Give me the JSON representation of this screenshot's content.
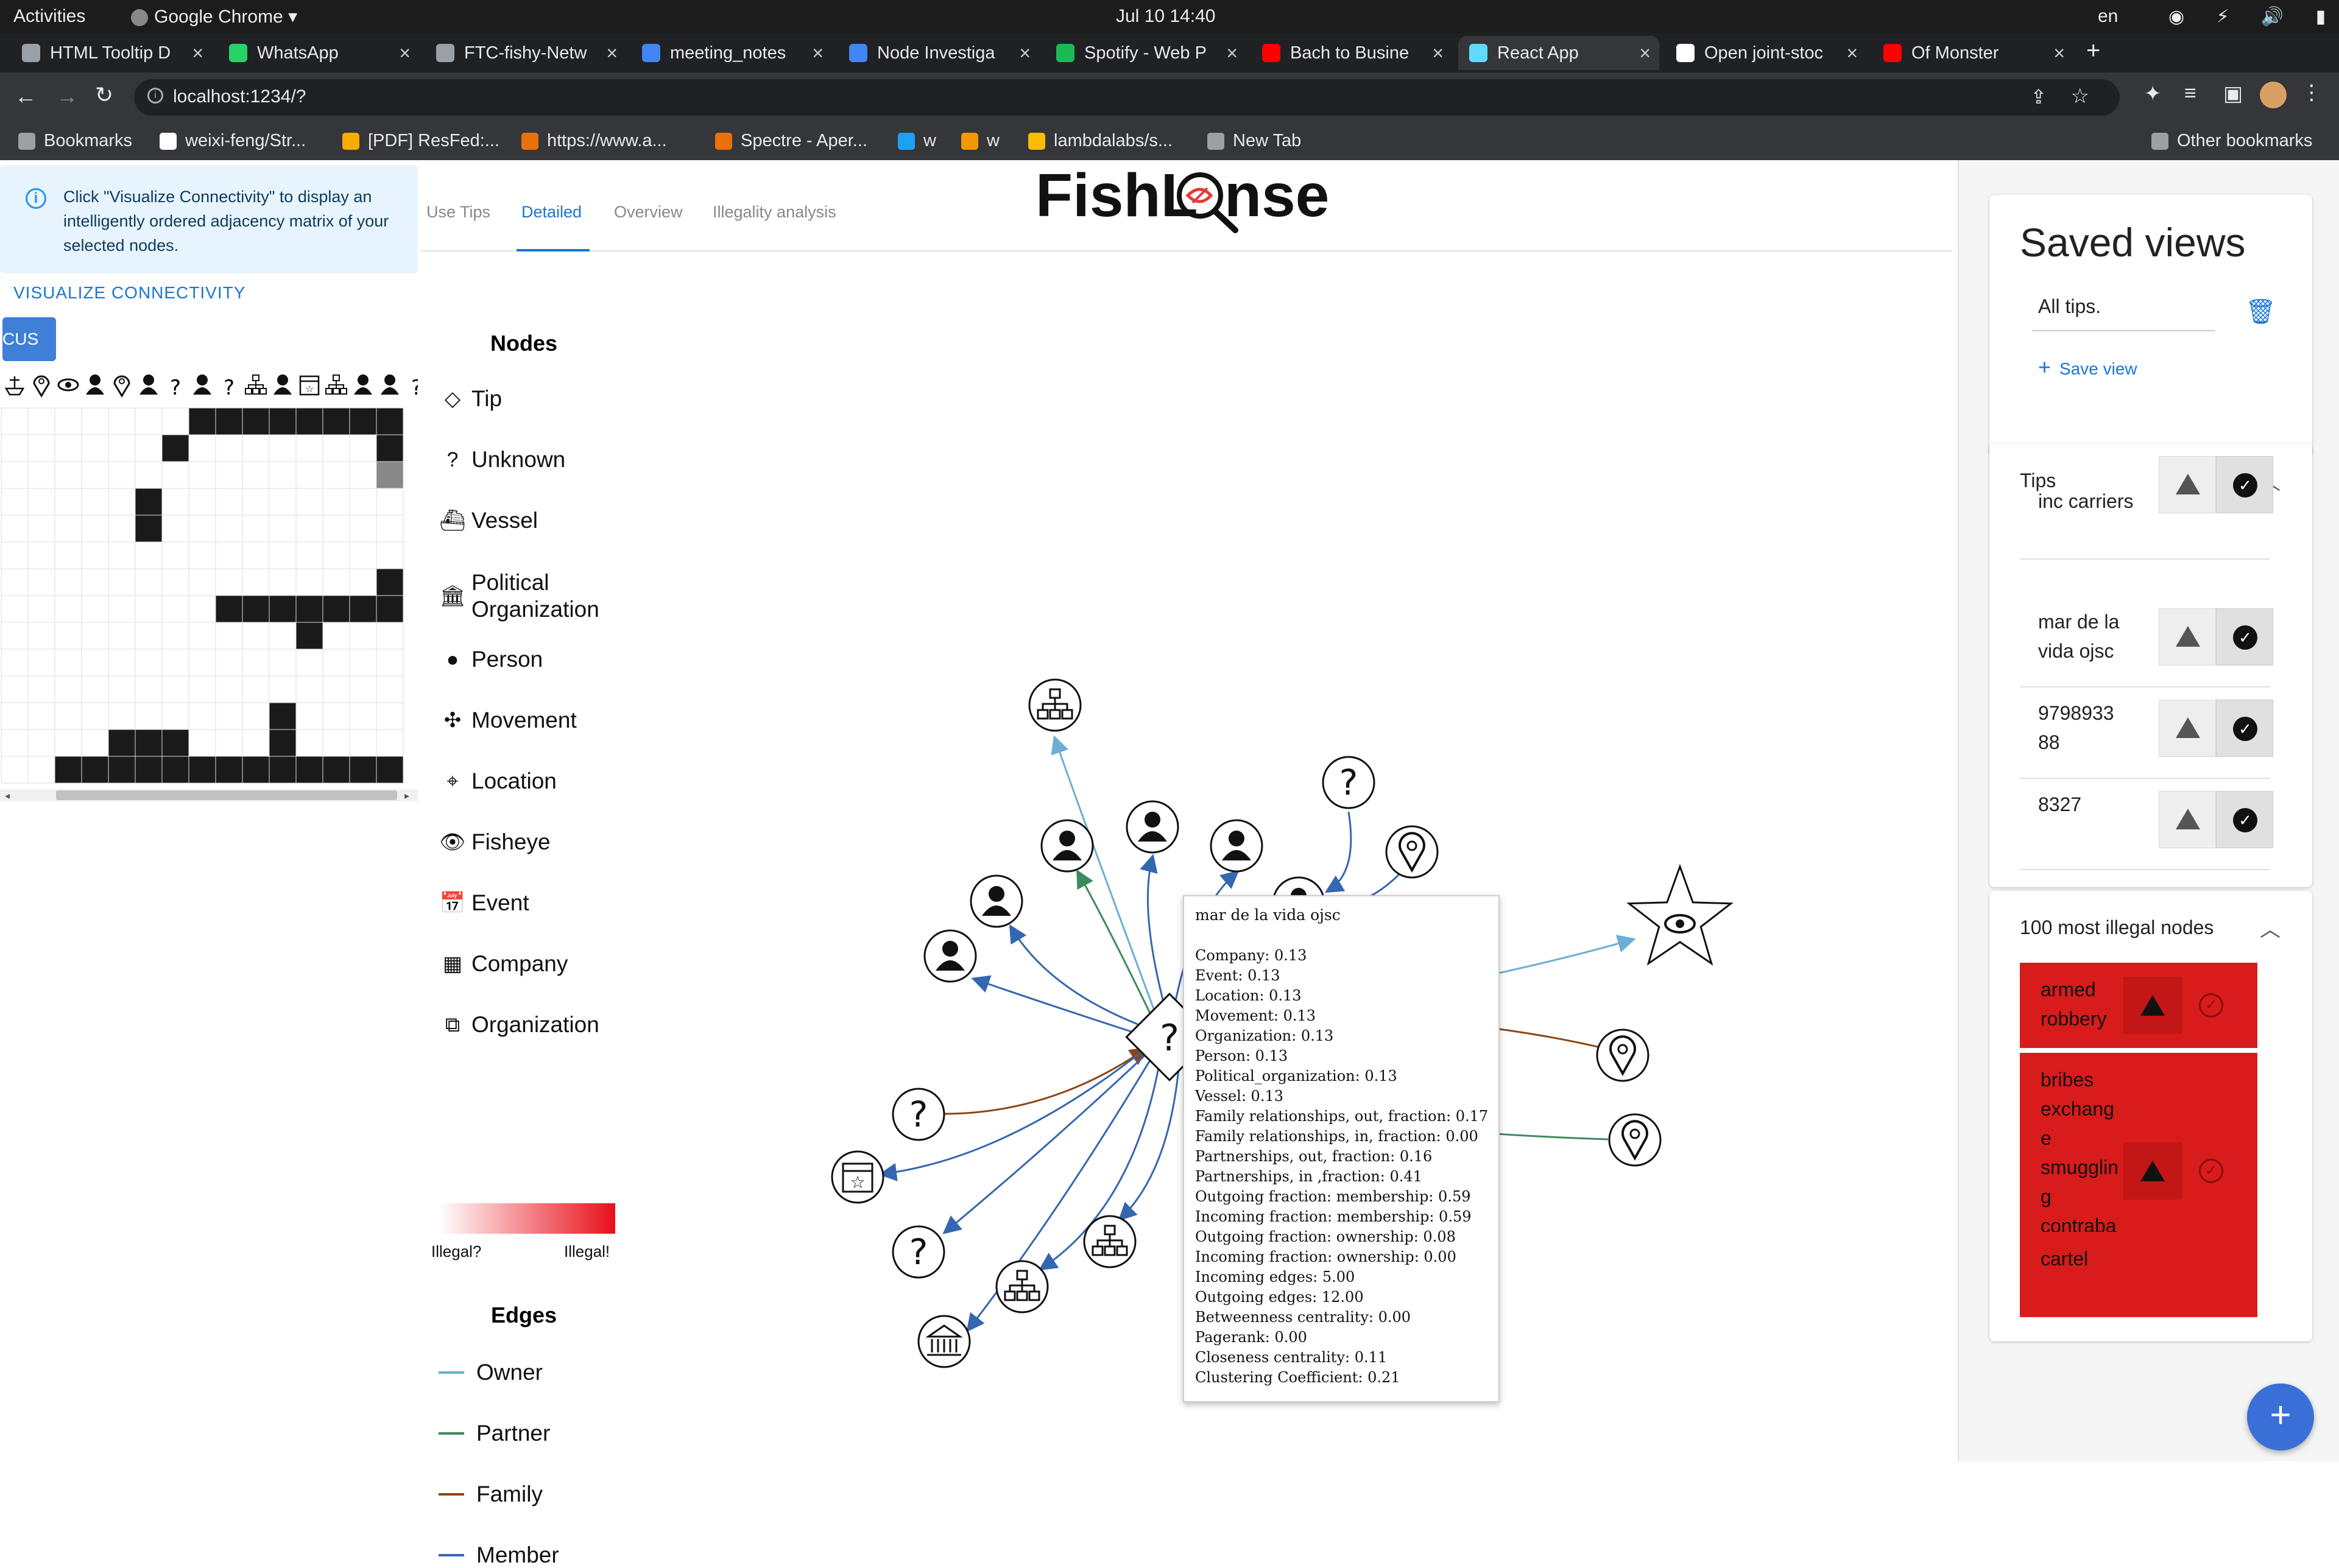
{
  "system": {
    "activities": "Activities",
    "app": "Google Chrome",
    "clock": "Jul 10  14:40",
    "lang": "en"
  },
  "tabs": [
    {
      "label": "HTML Tooltip D",
      "color": "#9aa0a6"
    },
    {
      "label": "WhatsApp",
      "color": "#25d366"
    },
    {
      "label": "FTC-fishy-Netw",
      "color": "#9aa0a6"
    },
    {
      "label": "meeting_notes",
      "color": "#4285f4"
    },
    {
      "label": "Node Investiga",
      "color": "#4285f4"
    },
    {
      "label": "Spotify - Web P",
      "color": "#1db954"
    },
    {
      "label": "Bach to Busine",
      "color": "#ff0000"
    },
    {
      "label": "React App",
      "color": "#61dafb"
    },
    {
      "label": "Open joint-stoc",
      "color": "#ffffff"
    },
    {
      "label": "Of Monster",
      "color": "#ff0000"
    }
  ],
  "address": {
    "url": "localhost:1234/?"
  },
  "bookmarks": [
    {
      "label": "Bookmarks",
      "color": "#9aa0a6"
    },
    {
      "label": "weixi-feng/Str...",
      "color": "#ffffff"
    },
    {
      "label": "[PDF] ResFed:...",
      "color": "#f9ab00"
    },
    {
      "label": "https://www.a...",
      "color": "#e8710a"
    },
    {
      "label": "Spectre - Aper...",
      "color": "#e8710a"
    },
    {
      "label": "w",
      "color": "#1da1f2"
    },
    {
      "label": "w",
      "color": "#f29900"
    },
    {
      "label": "lambdalabs/s...",
      "color": "#fbbc04"
    },
    {
      "label": "New Tab",
      "color": "#9aa0a6"
    },
    {
      "label": "Other bookmarks",
      "color": "#9aa0a6"
    }
  ],
  "left": {
    "info": "Click \"Visualize Connectivity\" to display an intelligently ordered adjacency matrix of your selected nodes.",
    "visualize": "VISUALIZE CONNECTIVITY",
    "cus": "CUS",
    "matrix_header": [
      "vessel",
      "location",
      "fisheye",
      "person",
      "location",
      "person",
      "?",
      "person",
      "?",
      "organization",
      "person",
      "event",
      "organization",
      "person",
      "person",
      "?"
    ],
    "matrix_rows": [
      [
        0,
        0,
        0,
        0,
        0,
        0,
        0,
        1,
        1,
        1,
        1,
        1,
        1,
        1,
        1
      ],
      [
        0,
        0,
        0,
        0,
        0,
        0,
        1,
        0,
        0,
        0,
        0,
        0,
        0,
        0,
        1
      ],
      [
        0,
        0,
        0,
        0,
        0,
        0,
        0,
        0,
        0,
        0,
        0,
        0,
        0,
        0,
        2
      ],
      [
        0,
        0,
        0,
        0,
        0,
        1,
        0,
        0,
        0,
        0,
        0,
        0,
        0,
        0,
        0
      ],
      [
        0,
        0,
        0,
        0,
        0,
        1,
        0,
        0,
        0,
        0,
        0,
        0,
        0,
        0,
        0
      ],
      [
        0,
        0,
        0,
        0,
        0,
        0,
        0,
        0,
        0,
        0,
        0,
        0,
        0,
        0,
        0
      ],
      [
        0,
        0,
        0,
        0,
        0,
        0,
        0,
        0,
        0,
        0,
        0,
        0,
        0,
        0,
        1
      ],
      [
        0,
        0,
        0,
        0,
        0,
        0,
        0,
        0,
        1,
        1,
        1,
        1,
        1,
        1,
        1
      ],
      [
        0,
        0,
        0,
        0,
        0,
        0,
        0,
        0,
        0,
        0,
        0,
        1,
        0,
        0,
        0
      ],
      [
        0,
        0,
        0,
        0,
        0,
        0,
        0,
        0,
        0,
        0,
        0,
        0,
        0,
        0,
        0
      ],
      [
        0,
        0,
        0,
        0,
        0,
        0,
        0,
        0,
        0,
        0,
        0,
        0,
        0,
        0,
        0
      ],
      [
        0,
        0,
        0,
        0,
        0,
        0,
        0,
        0,
        0,
        0,
        1,
        0,
        0,
        0,
        0
      ],
      [
        0,
        0,
        0,
        0,
        1,
        1,
        1,
        0,
        0,
        0,
        1,
        0,
        0,
        0,
        0
      ],
      [
        0,
        0,
        1,
        1,
        1,
        1,
        1,
        1,
        1,
        1,
        1,
        1,
        1,
        1,
        1
      ]
    ]
  },
  "panel_tabs": [
    "Use Tips",
    "Detailed",
    "Overview",
    "Illegality analysis"
  ],
  "logo": {
    "left": "FishL",
    "right": "nse",
    "accent": "#e53935"
  },
  "legend": {
    "nodes_title": "Nodes",
    "nodes": [
      {
        "glyph": "◇",
        "label": "Tip"
      },
      {
        "glyph": "?",
        "label": "Unknown"
      },
      {
        "glyph": "⛴",
        "label": "Vessel"
      },
      {
        "glyph": "🏛",
        "label": "Political Organization"
      },
      {
        "glyph": "●",
        "label": "Person"
      },
      {
        "glyph": "✣",
        "label": "Movement"
      },
      {
        "glyph": "⌖",
        "label": "Location"
      },
      {
        "glyph": "👁",
        "label": "Fisheye"
      },
      {
        "glyph": "📅",
        "label": "Event"
      },
      {
        "glyph": "▦",
        "label": "Company"
      },
      {
        "glyph": "⧉",
        "label": "Organization"
      }
    ],
    "scale_left": "Illegal?",
    "scale_right": "Illegal!",
    "edges_title": "Edges",
    "edges": [
      {
        "label": "Owner",
        "color": "#6baed6"
      },
      {
        "label": "Partner",
        "color": "#3a8c5c"
      },
      {
        "label": "Family",
        "color": "#8b4513"
      },
      {
        "label": "Member",
        "color": "#3566b0"
      }
    ]
  },
  "graph": {
    "center": {
      "type": "tip",
      "label": "?"
    },
    "nodes": [
      {
        "type": "organization"
      },
      {
        "type": "person"
      },
      {
        "type": "person"
      },
      {
        "type": "person"
      },
      {
        "type": "unknown",
        "label": "?"
      },
      {
        "type": "location"
      },
      {
        "type": "person"
      },
      {
        "type": "person"
      },
      {
        "type": "person"
      },
      {
        "type": "fisheye"
      },
      {
        "type": "location"
      },
      {
        "type": "location"
      },
      {
        "type": "unknown",
        "label": "?"
      },
      {
        "type": "event"
      },
      {
        "type": "unknown",
        "label": "?"
      },
      {
        "type": "political"
      },
      {
        "type": "organization"
      },
      {
        "type": "organization"
      }
    ]
  },
  "tooltip": {
    "title": "mar de la vida ojsc",
    "lines": [
      "Company: 0.13",
      "Event: 0.13",
      "Location: 0.13",
      "Movement: 0.13",
      "Organization: 0.13",
      "Person: 0.13",
      "Political_organization: 0.13",
      "Vessel: 0.13",
      "Family relationships, out, fraction: 0.17",
      "Family relationships, in, fraction: 0.00",
      "Partnerships, out, fraction: 0.16",
      "Partnerships, in ,fraction: 0.41",
      "Outgoing fraction: membership: 0.59",
      "Incoming fraction: membership: 0.59",
      "Outgoing fraction: ownership: 0.08",
      "Incoming fraction: ownership: 0.00",
      "Incoming edges: 5.00",
      "Outgoing edges: 12.00",
      "Betweenness centrality: 0.00",
      "Pagerank: 0.00",
      "Closeness centrality: 0.11",
      "Clustering Coefficient: 0.21"
    ]
  },
  "saved_views": {
    "title": "Saved views",
    "item": "All tips.",
    "save": "Save view"
  },
  "tips": {
    "title": "Tips",
    "items": [
      "inc carriers",
      "mar de la vida ojsc",
      "9798933 88",
      "8327"
    ]
  },
  "illegal": {
    "title": "100 most illegal nodes",
    "items": [
      "armed robbery",
      "bribes exchang e smugglin g contraba nd",
      "cartel"
    ]
  },
  "fab": "+"
}
